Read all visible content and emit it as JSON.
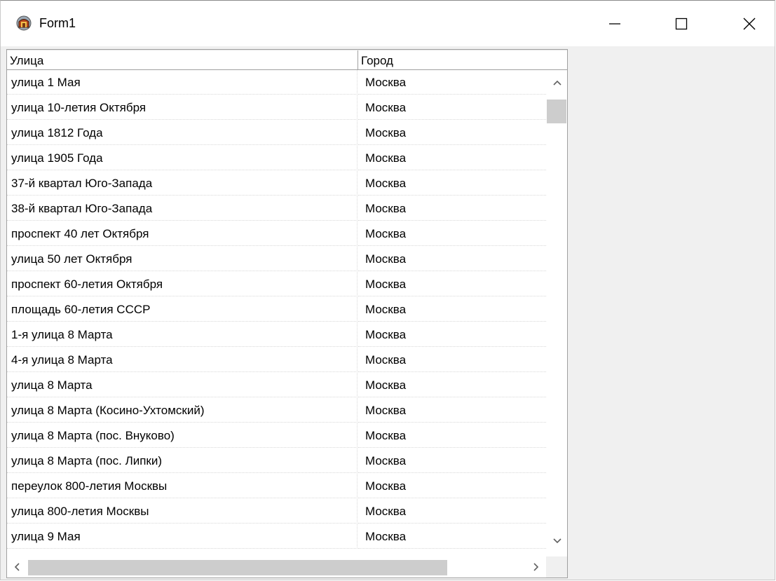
{
  "window": {
    "title": "Form1",
    "icon": "app-icon",
    "controls": [
      "minimize-icon",
      "maximize-icon",
      "close-icon"
    ]
  },
  "grid": {
    "columns": [
      "Улица",
      "Город"
    ],
    "rows": [
      [
        "улица 1 Мая",
        "Москва"
      ],
      [
        "улица 10-летия Октября",
        "Москва"
      ],
      [
        "улица 1812 Года",
        "Москва"
      ],
      [
        "улица 1905 Года",
        "Москва"
      ],
      [
        "37-й квартал Юго-Запада",
        "Москва"
      ],
      [
        "38-й квартал Юго-Запада",
        "Москва"
      ],
      [
        "проспект 40 лет Октября",
        "Москва"
      ],
      [
        "улица 50 лет Октября",
        "Москва"
      ],
      [
        "проспект 60-летия Октября",
        "Москва"
      ],
      [
        "площадь 60-летия СССР",
        "Москва"
      ],
      [
        "1-я улица 8 Марта",
        "Москва"
      ],
      [
        "4-я улица 8 Марта",
        "Москва"
      ],
      [
        "улица 8 Марта",
        "Москва"
      ],
      [
        "улица 8 Марта (Косино-Ухтомский)",
        "Москва"
      ],
      [
        "улица 8 Марта (пос. Внуково)",
        "Москва"
      ],
      [
        "улица 8 Марта (пос. Липки)",
        "Москва"
      ],
      [
        "переулок 800-летия Москвы",
        "Москва"
      ],
      [
        "улица 800-летия Москвы",
        "Москва"
      ],
      [
        "улица 9 Мая",
        "Москва"
      ]
    ]
  }
}
